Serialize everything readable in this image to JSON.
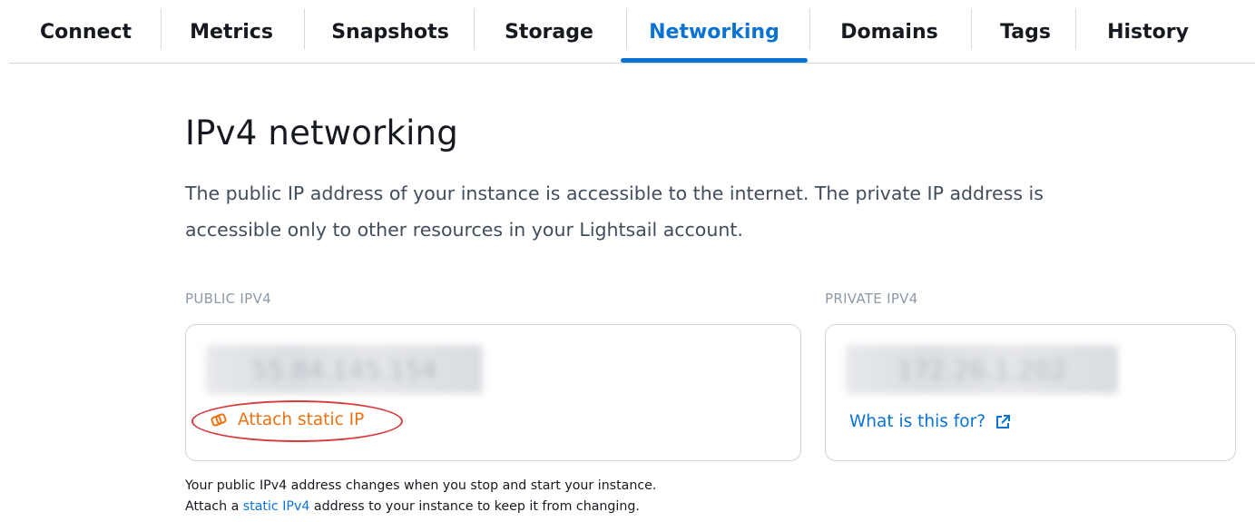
{
  "tabs": [
    {
      "label": "Connect",
      "active": false
    },
    {
      "label": "Metrics",
      "active": false
    },
    {
      "label": "Snapshots",
      "active": false
    },
    {
      "label": "Storage",
      "active": false
    },
    {
      "label": "Networking",
      "active": true
    },
    {
      "label": "Domains",
      "active": false
    },
    {
      "label": "Tags",
      "active": false
    },
    {
      "label": "History",
      "active": false
    }
  ],
  "section": {
    "title": "IPv4 networking",
    "description": "The public IP address of your instance is accessible to the internet. The private IP address is accessible only to other resources in your Lightsail account."
  },
  "public_ip": {
    "label": "PUBLIC IPV4",
    "address_redacted": "55.84.145.154",
    "attach_link": "Attach static IP",
    "attach_icon": "chain-link-icon"
  },
  "private_ip": {
    "label": "PRIVATE IPV4",
    "address_redacted": "172.26.1.202",
    "info_link": "What is this for?",
    "info_icon": "external-link-icon"
  },
  "help": {
    "line1": "Your public IPv4 address changes when you stop and start your instance.",
    "line2_prefix": "Attach a ",
    "line2_link": "static IPv4",
    "line2_suffix": " address to your instance to keep it from changing."
  },
  "colors": {
    "accent": "#0972d3",
    "orange": "#ec7211",
    "highlight_red": "#d63a3a"
  }
}
